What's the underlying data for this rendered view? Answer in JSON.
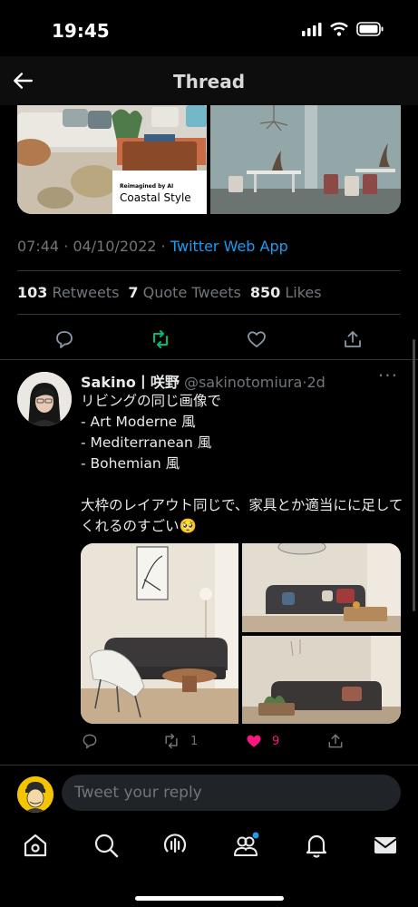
{
  "status_bar": {
    "time": "19:45"
  },
  "header": {
    "title": "Thread"
  },
  "tweet_media": {
    "caption_small": "Reimagined by AI",
    "caption_big": "Coastal Style"
  },
  "tweet_meta": {
    "time": "07:44",
    "date": "04/10/2022",
    "source": "Twitter Web App"
  },
  "stats": {
    "retweets_count": "103",
    "retweets_label": "Retweets",
    "quotes_count": "7",
    "quotes_label": "Quote Tweets",
    "likes_count": "850",
    "likes_label": "Likes"
  },
  "reply": {
    "name": "Sakino丨咲野",
    "handle": "@sakinotomiura",
    "time": "2d",
    "lines": [
      "リビングの同じ画像で",
      "- Art Moderne 風",
      "- Mediterranean 風",
      "- Bohemian 風",
      "",
      "大枠のレイアウト同じで、家具とか適当にに足して",
      "くれるのすごい🥺"
    ],
    "retweets": "1",
    "likes": "9"
  },
  "composer": {
    "placeholder": "Tweet your reply"
  },
  "colors": {
    "accent": "#1d9bf0",
    "retweet_green": "#00ba7c",
    "like_pink": "#f91880",
    "background": "#000000"
  },
  "icons": {
    "back": "back-arrow-icon",
    "reply": "reply-icon",
    "retweet": "retweet-icon",
    "like": "heart-icon",
    "share": "share-icon",
    "more": "more-dots-icon",
    "tabs": [
      "home-icon",
      "search-icon",
      "spaces-icon",
      "communities-icon",
      "notifications-icon",
      "messages-icon"
    ]
  }
}
